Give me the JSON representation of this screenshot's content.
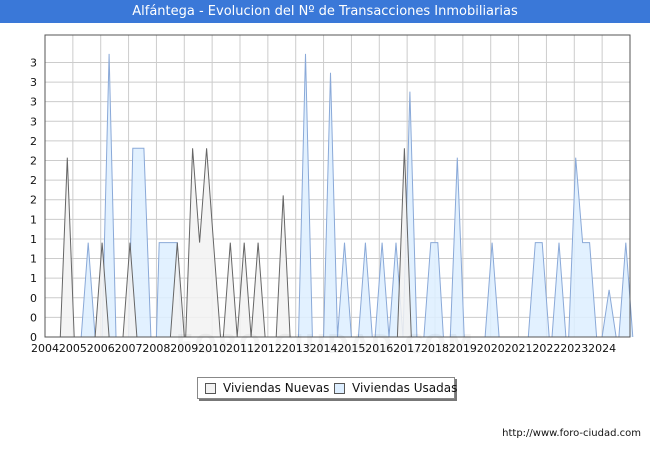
{
  "header": {
    "title": "Alfántega - Evolucion del Nº de Transacciones Inmobiliarias"
  },
  "footer": {
    "url": "http://www.foro-ciudad.com"
  },
  "watermark": {
    "text": "FORO-CIUDAD.COM"
  },
  "legend": {
    "items": [
      {
        "label": "Viviendas Nuevas",
        "color": "#f2f2f2"
      },
      {
        "label": "Viviendas Usadas",
        "color": "#ddeeff"
      }
    ]
  },
  "colors": {
    "nuevas_fill": "#f2f2f2",
    "nuevas_stroke": "#666666",
    "usadas_fill": "#ddeeff",
    "usadas_stroke": "#8aa9d8",
    "grid": "#cccccc",
    "axis": "#000000"
  },
  "chart_data": {
    "type": "area",
    "x_start_year": 2004,
    "x_end_year": 2024,
    "x_tick_labels": [
      "2004",
      "2005",
      "2006",
      "2007",
      "2008",
      "2009",
      "2010",
      "2011",
      "2012",
      "2013",
      "2014",
      "2015",
      "2016",
      "2017",
      "2018",
      "2019",
      "2020",
      "2021",
      "2022",
      "2023",
      "2024"
    ],
    "y_tick_labels": [
      "0",
      "0",
      "0",
      "1",
      "1",
      "1",
      "1",
      "2",
      "2",
      "2",
      "2",
      "3",
      "3",
      "3",
      "3"
    ],
    "ylim": [
      0,
      3.2
    ],
    "grid": true,
    "legend_position": "bottom-center",
    "series": [
      {
        "name": "Viviendas Nuevas",
        "points": [
          [
            2004.0,
            0
          ],
          [
            2004.55,
            0
          ],
          [
            2004.8,
            1.9
          ],
          [
            2005.05,
            0
          ],
          [
            2005.8,
            0
          ],
          [
            2006.05,
            1
          ],
          [
            2006.3,
            0
          ],
          [
            2006.8,
            0
          ],
          [
            2007.05,
            1
          ],
          [
            2007.3,
            0
          ],
          [
            2008.5,
            0
          ],
          [
            2008.75,
            1
          ],
          [
            2009.0,
            0
          ],
          [
            2009.05,
            0
          ],
          [
            2009.3,
            2
          ],
          [
            2009.55,
            1
          ],
          [
            2009.8,
            2
          ],
          [
            2010.05,
            1
          ],
          [
            2010.3,
            0
          ],
          [
            2010.4,
            0
          ],
          [
            2010.65,
            1
          ],
          [
            2010.9,
            0
          ],
          [
            2010.9,
            0
          ],
          [
            2011.15,
            1
          ],
          [
            2011.4,
            0
          ],
          [
            2011.4,
            0
          ],
          [
            2011.65,
            1
          ],
          [
            2011.9,
            0
          ],
          [
            2012.3,
            0
          ],
          [
            2012.55,
            1.5
          ],
          [
            2012.8,
            0
          ],
          [
            2015.0,
            0
          ],
          [
            2015.0,
            0
          ],
          [
            2016.65,
            0
          ],
          [
            2016.9,
            2
          ],
          [
            2017.15,
            0
          ],
          [
            2024.7,
            0
          ]
        ]
      },
      {
        "name": "Viviendas Usadas",
        "points": [
          [
            2004.0,
            0
          ],
          [
            2005.3,
            0
          ],
          [
            2005.55,
            1
          ],
          [
            2005.8,
            0
          ],
          [
            2006.05,
            0
          ],
          [
            2006.3,
            3
          ],
          [
            2006.55,
            0
          ],
          [
            2007.0,
            0
          ],
          [
            2007.15,
            2
          ],
          [
            2007.55,
            2
          ],
          [
            2007.8,
            0
          ],
          [
            2008.0,
            0
          ],
          [
            2008.1,
            1
          ],
          [
            2008.75,
            1
          ],
          [
            2008.9,
            0
          ],
          [
            2013.1,
            0
          ],
          [
            2013.35,
            3
          ],
          [
            2013.6,
            0
          ],
          [
            2014.0,
            0
          ],
          [
            2014.25,
            2.8
          ],
          [
            2014.5,
            0
          ],
          [
            2014.5,
            0
          ],
          [
            2014.75,
            1
          ],
          [
            2015.0,
            0
          ],
          [
            2015.25,
            0
          ],
          [
            2015.5,
            1
          ],
          [
            2015.75,
            0
          ],
          [
            2015.85,
            0
          ],
          [
            2016.1,
            1
          ],
          [
            2016.35,
            0
          ],
          [
            2016.35,
            0
          ],
          [
            2016.6,
            1
          ],
          [
            2016.85,
            0
          ],
          [
            2016.85,
            0
          ],
          [
            2017.1,
            2.6
          ],
          [
            2017.35,
            0
          ],
          [
            2017.6,
            0
          ],
          [
            2017.85,
            1
          ],
          [
            2018.1,
            1
          ],
          [
            2018.3,
            0
          ],
          [
            2018.55,
            0
          ],
          [
            2018.8,
            1.9
          ],
          [
            2019.05,
            0
          ],
          [
            2019.8,
            0
          ],
          [
            2020.05,
            1
          ],
          [
            2020.3,
            0
          ],
          [
            2021.35,
            0
          ],
          [
            2021.6,
            1
          ],
          [
            2021.85,
            1
          ],
          [
            2022.1,
            0
          ],
          [
            2022.2,
            0
          ],
          [
            2022.45,
            1
          ],
          [
            2022.7,
            0
          ],
          [
            2022.8,
            0
          ],
          [
            2023.05,
            1.9
          ],
          [
            2023.3,
            1
          ],
          [
            2023.55,
            1
          ],
          [
            2023.8,
            0
          ],
          [
            2024.0,
            0
          ],
          [
            2024.25,
            0.5
          ],
          [
            2024.5,
            0
          ],
          [
            2024.6,
            0
          ],
          [
            2024.85,
            1
          ],
          [
            2025.1,
            0
          ]
        ]
      }
    ]
  }
}
